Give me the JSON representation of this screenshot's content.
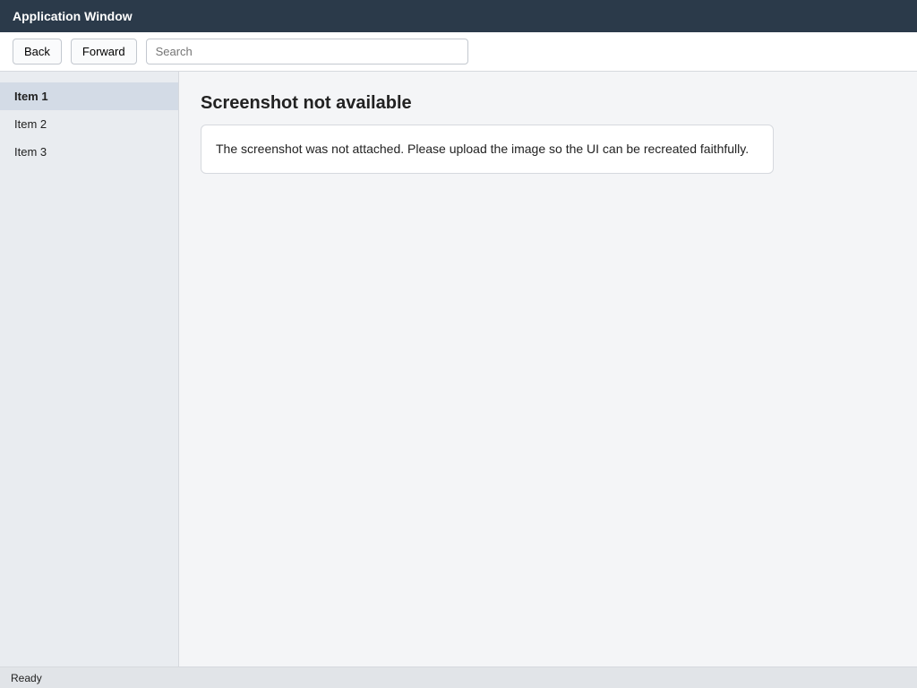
{
  "window": {
    "title": "Application Window"
  },
  "toolbar": {
    "back_label": "Back",
    "forward_label": "Forward",
    "search_placeholder": "Search"
  },
  "sidebar": {
    "items": [
      {
        "label": "Item 1"
      },
      {
        "label": "Item 2"
      },
      {
        "label": "Item 3"
      }
    ]
  },
  "main": {
    "heading": "Screenshot not available",
    "notice": "The screenshot was not attached. Please upload the image so the UI can be recreated faithfully."
  },
  "status": {
    "text": "Ready"
  }
}
